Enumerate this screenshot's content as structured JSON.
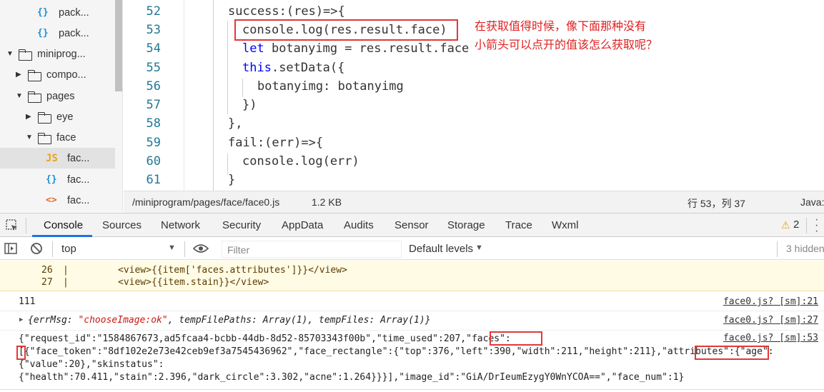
{
  "file_tree": {
    "items": [
      {
        "icon": "{}",
        "label": "pack..."
      },
      {
        "icon": "{}",
        "label": "pack..."
      },
      {
        "label": "miniprog..."
      },
      {
        "label": "compo..."
      },
      {
        "label": "pages"
      },
      {
        "label": "eye"
      },
      {
        "label": "face"
      },
      {
        "icon": "JS",
        "label": "fac..."
      },
      {
        "icon": "{}",
        "label": "fac..."
      },
      {
        "icon": "<>",
        "label": "fac..."
      }
    ]
  },
  "editor": {
    "line_numbers": [
      "52",
      "53",
      "54",
      "55",
      "56",
      "57",
      "58",
      "59",
      "60",
      "61"
    ],
    "lines": [
      "success:(res)=>{",
      "console.log(res.result.face)",
      "let",
      " botanyimg = res.result.face",
      "this",
      ".setData({",
      "botanyimg: botanyimg",
      "})",
      "},",
      "fail:(err)=>{",
      "console.log(err)",
      "}"
    ],
    "annotation_line1": "在获取值得时候，像下面那种没有",
    "annotation_line2": "小箭头可以点开的值该怎么获取呢？"
  },
  "status_bar": {
    "path": "/miniprogram/pages/face/face0.js",
    "size": "1.2 KB",
    "position": "行 53，列 37",
    "language": "Java:"
  },
  "devtools": {
    "tabs": [
      "Console",
      "Sources",
      "Network",
      "Security",
      "AppData",
      "Audits",
      "Sensor",
      "Storage",
      "Trace",
      "Wxml"
    ],
    "warning_count": "2",
    "context": "top",
    "filter_placeholder": "Filter",
    "levels": "Default levels",
    "hidden": "3 hidden"
  },
  "console": {
    "warn_lines": [
      {
        "num": "26",
        "code": "<view>{{item['faces.attributes']}}</view>"
      },
      {
        "num": "27",
        "code": "<view>{{item.stain}}</view>"
      }
    ],
    "log1": {
      "text": "111",
      "source": "face0.js? [sm]:21"
    },
    "log2": {
      "open": "{errMsg: ",
      "errmsg": "\"chooseImage:ok\"",
      "rest": ", tempFilePaths: Array(1), tempFiles: Array(1)}",
      "source": "face0.js? [sm]:27"
    },
    "log3": {
      "line1": "{\"request_id\":\"1584867673,ad5fcaa4-bcbb-44db-8d52-85703343f00b\",\"time_used\":207,\"faces\":",
      "line2": "[{\"face_token\":\"8df102e2e73e42ceb9ef3a7545436962\",\"face_rectangle\":{\"top\":376,\"left\":390,\"width\":211,\"height\":211},\"attributes\":{\"age\":",
      "line3": "{\"value\":20},\"skinstatus\":",
      "line4": "{\"health\":70.411,\"stain\":2.396,\"dark_circle\":3.302,\"acne\":1.264}}}],\"image_id\":\"GiA/DrIeumEzygY0WnYCOA==\",\"face_num\":1}",
      "source": "face0.js? [sm]:53"
    }
  }
}
